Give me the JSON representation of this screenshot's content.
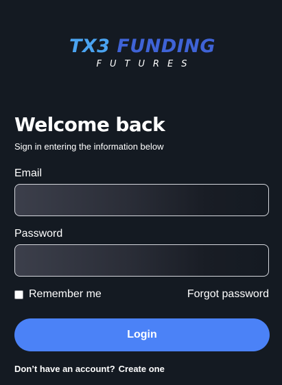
{
  "brand": {
    "logo_part1": "TX3",
    "logo_part2": " FUNDING",
    "logo_sub": "FUTURES"
  },
  "header": {
    "title": "Welcome back",
    "subtitle": "Sign in entering the information below"
  },
  "form": {
    "email_label": "Email",
    "email_value": "",
    "password_label": "Password",
    "password_value": "",
    "remember_label": "Remember me",
    "remember_checked": false,
    "forgot_label": "Forgot password",
    "login_label": "Login"
  },
  "footer": {
    "prompt": "Don’t have an account?",
    "create_label": "Create one"
  },
  "colors": {
    "background": "#141a22",
    "accent": "#4b82f7",
    "logo_light_blue": "#4aa3f0",
    "logo_blue": "#3f63d6"
  }
}
